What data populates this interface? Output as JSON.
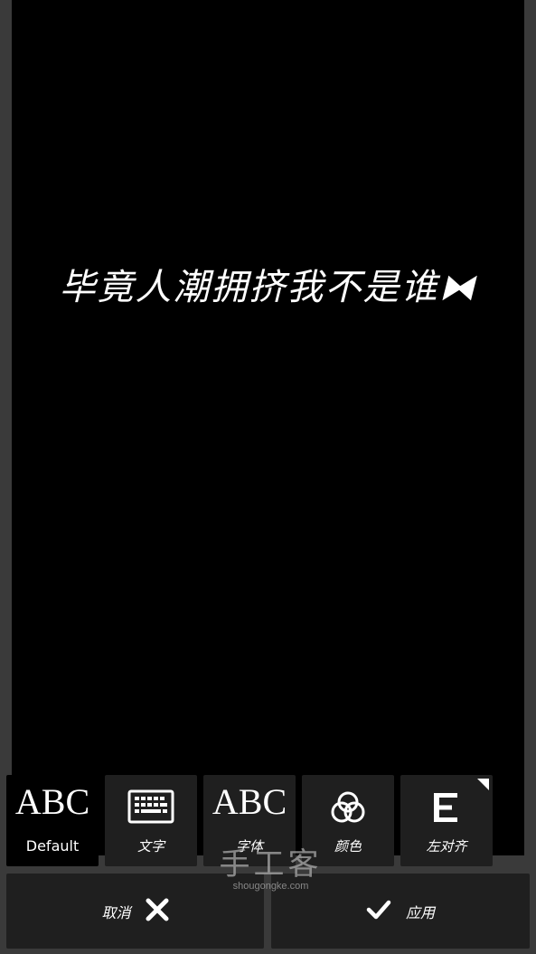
{
  "canvas": {
    "overlay_text": "毕竟人潮拥挤我不是谁⧓"
  },
  "toolbar": {
    "default_sample": "ABC",
    "default_label": "Default",
    "keyboard_label": "文字",
    "font_sample": "ABC",
    "font_label": "字体",
    "color_label": "颜色",
    "align_label": "左对齐"
  },
  "actions": {
    "cancel_label": "取消",
    "apply_label": "应用"
  },
  "watermark": {
    "line1": "手工客",
    "line2": "shougongke.com"
  }
}
